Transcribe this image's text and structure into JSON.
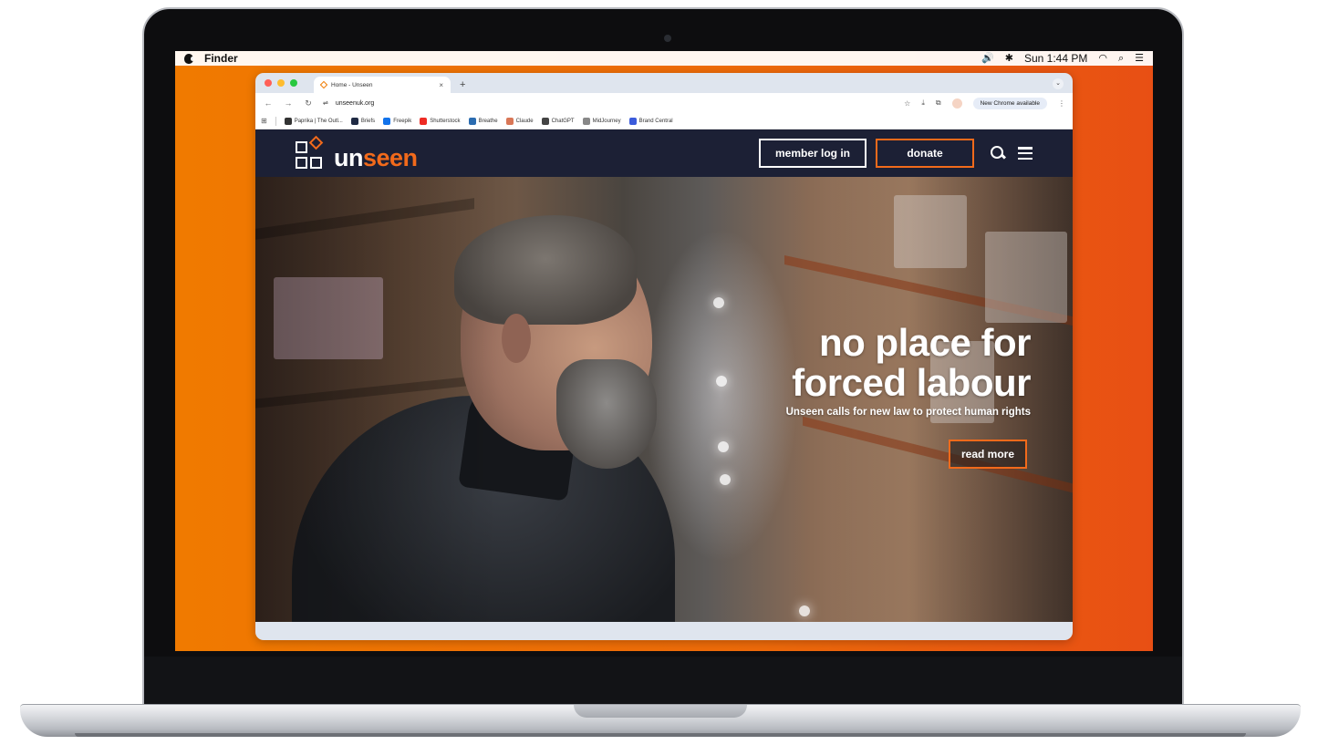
{
  "macos": {
    "app_name": "Finder",
    "clock": "Sun 1:44 PM"
  },
  "browser": {
    "tab_title": "Home - Unseen",
    "new_tab_symbol": "+",
    "close_tab_symbol": "×",
    "url": "unseenuk.org",
    "update_chip": "New Chrome available",
    "bookmarks": [
      {
        "label": "Paprika | The Outl...",
        "color": "#333333"
      },
      {
        "label": "Briefs",
        "color": "#1f2a44"
      },
      {
        "label": "Freepik",
        "color": "#1273eb"
      },
      {
        "label": "Shutterstock",
        "color": "#ee2b24"
      },
      {
        "label": "Breathe",
        "color": "#2b6cb0"
      },
      {
        "label": "Claude",
        "color": "#d97757"
      },
      {
        "label": "ChatGPT",
        "color": "#444444"
      },
      {
        "label": "MidJourney",
        "color": "#888888"
      },
      {
        "label": "Brand Central",
        "color": "#3b5bdb"
      }
    ]
  },
  "site": {
    "logo_text_plain": "un",
    "logo_text_accent": "seen",
    "member_login_label": "member log in",
    "donate_label": "donate",
    "hero": {
      "title_line1": "no place for",
      "title_line2": "forced labour",
      "subtitle": "Unseen calls for new law to protect human rights",
      "cta_label": "read more"
    }
  },
  "colors": {
    "brand_orange": "#f26a1b",
    "header_navy": "#1c2035",
    "desktop_orange": "#f07a00"
  }
}
